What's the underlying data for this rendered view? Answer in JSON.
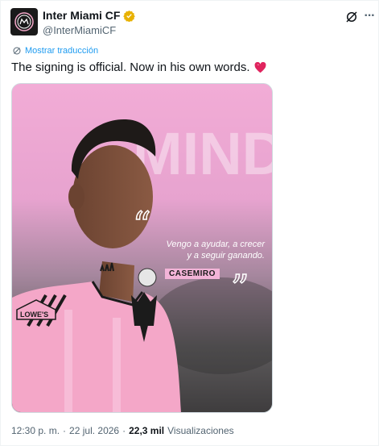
{
  "author": {
    "display_name": "Inter Miami CF",
    "handle": "@InterMiamiCF",
    "verified_color": "#e8b100"
  },
  "translate_label": "Mostrar traducción",
  "tweet_text": "The signing is official. Now in his own words.",
  "media": {
    "background_word": "MIND",
    "quote_line1": "Vengo a ayudar, a crecer",
    "quote_line2": "y a seguir ganando.",
    "quote_author": "CASEMIRO",
    "sponsor_patch": "LOWE'S"
  },
  "meta": {
    "time": "12:30 p. m.",
    "separator": "·",
    "date": "22 jul. 2026",
    "views_count": "22,3 mil",
    "views_label": "Visualizaciones"
  },
  "colors": {
    "accent": "#1d9bf0",
    "kit_pink": "#f4a7c8",
    "heart": "#e0245e"
  }
}
